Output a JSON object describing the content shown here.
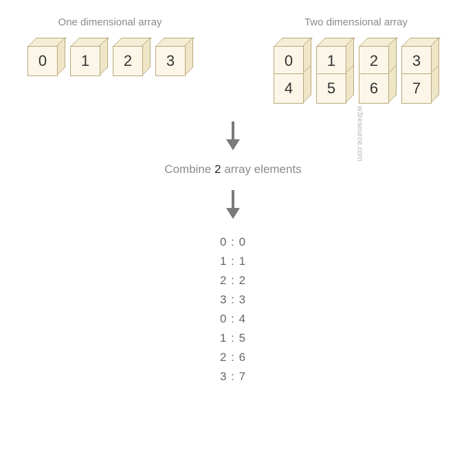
{
  "left": {
    "title": "One dimensional array",
    "values": [
      0,
      1,
      2,
      3
    ]
  },
  "right": {
    "title": "Two dimensional array",
    "row1": [
      0,
      1,
      2,
      3
    ],
    "row2": [
      4,
      5,
      6,
      7
    ]
  },
  "combine": {
    "prefix": "Combine ",
    "count": "2",
    "suffix": " array elements"
  },
  "output": [
    "0 : 0",
    "1 : 1",
    "2 : 2",
    "3 : 3",
    "0 : 4",
    "1 : 5",
    "2 : 6",
    "3 : 7"
  ],
  "credit": "w3resource.com",
  "arrow_color": "#7a7a7a"
}
